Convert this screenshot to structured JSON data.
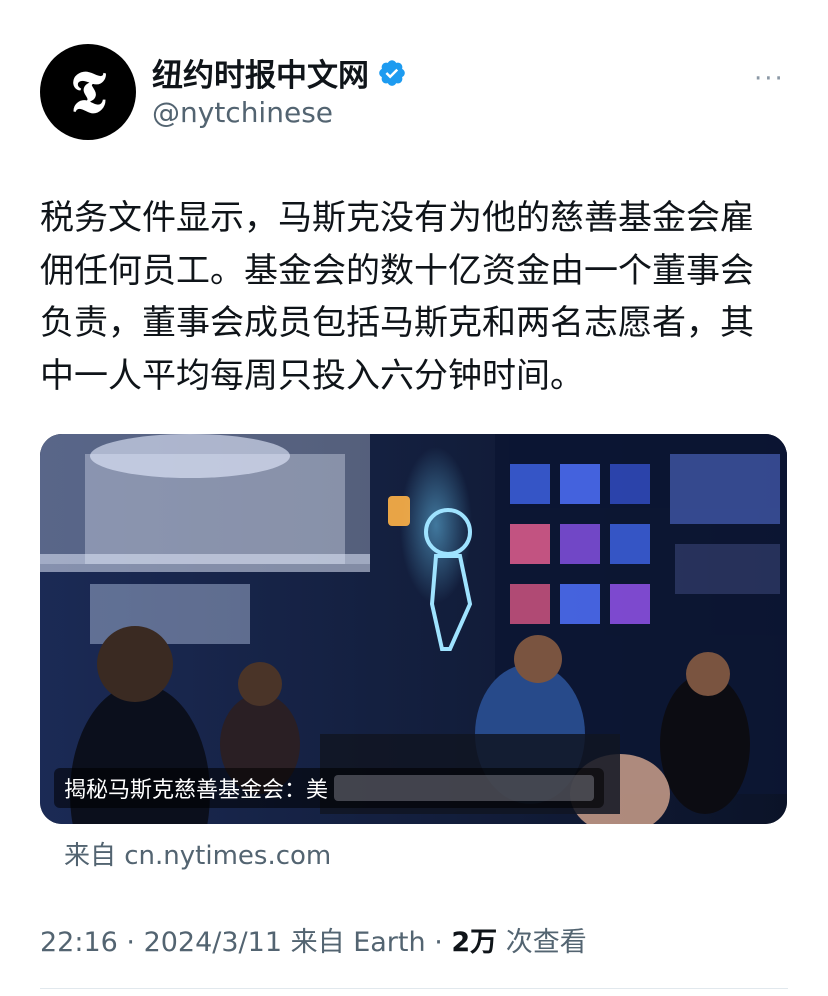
{
  "account": {
    "avatar_glyph": "𝕿",
    "display_name": "纽约时报中文网",
    "verified": true,
    "handle": "@nytchinese"
  },
  "menu": {
    "more_icon": "···"
  },
  "tweet": {
    "text": "税务文件显示，马斯克没有为他的慈善基金会雇佣任何员工。基金会的数十亿资金由一个董事会负责，董事会成员包括马斯克和两名志愿者，其中一人平均每周只投入六分钟时间。"
  },
  "media": {
    "caption": "揭秘马斯克慈善基金会：",
    "caption_partial": "美"
  },
  "source": {
    "label": "来自 cn.nytimes.com"
  },
  "meta": {
    "time": "22:16",
    "date": "2024/3/11",
    "sep1": " · ",
    "from": "来自 Earth",
    "sep2": " · ",
    "views_count": "2万",
    "views_label": " 次查看"
  },
  "colors": {
    "verified": "#1d9bf0",
    "muted": "#536471",
    "text": "#0f1419"
  }
}
